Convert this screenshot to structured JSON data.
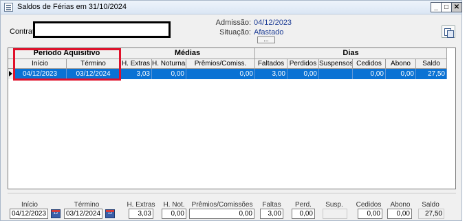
{
  "window": {
    "title": "Saldos de Férias em 31/10/2024",
    "minimize": "_",
    "maximize": "□",
    "close": "✕"
  },
  "info": {
    "contrato_label": "Contrato",
    "admissao_label": "Admissão:",
    "admissao_value": "04/12/2023",
    "situacao_label": "Situação:",
    "situacao_value": "Afastado",
    "dots_button": "..."
  },
  "grid": {
    "groups": {
      "periodo": "Período Aquisitivo",
      "medias": "Médias",
      "dias": "Dias"
    },
    "columns": [
      "Início",
      "Término",
      "H. Extras",
      "H. Noturnas",
      "Prêmios/Comiss.",
      "Faltados",
      "Perdidos",
      "Suspensos",
      "Cedidos",
      "Abono",
      "Saldo"
    ],
    "rows": [
      [
        "04/12/2023",
        "03/12/2024",
        "3,03",
        "0,00",
        "0,00",
        "3,00",
        "0,00",
        "",
        "0,00",
        "0,00",
        "27,50"
      ]
    ]
  },
  "footer": {
    "labels": {
      "inicio": "Início",
      "termino": "Término",
      "h_extras": "H. Extras",
      "h_not": "H. Not.",
      "premios": "Prêmios/Comissões",
      "faltas": "Faltas",
      "perd": "Perd.",
      "susp": "Susp.",
      "cedidos": "Cedidos",
      "abono": "Abono",
      "saldo": "Saldo"
    },
    "values": {
      "inicio": "04/12/2023",
      "termino": "03/12/2024",
      "h_extras": "3,03",
      "h_not": "0,00",
      "premios": "0,00",
      "faltas": "3,00",
      "perd": "0,00",
      "susp": "",
      "cedidos": "0,00",
      "abono": "0,00",
      "saldo": "27,50"
    },
    "calendar_icon_text": "12"
  },
  "colors": {
    "selection": "#0a72d4",
    "highlight": "#e0102a",
    "link_value": "#1a3a94"
  },
  "icons": [
    "window-icon",
    "minimize-icon",
    "maximize-icon",
    "close-icon",
    "copy-icon",
    "calendar-icon",
    "row-indicator-icon"
  ]
}
